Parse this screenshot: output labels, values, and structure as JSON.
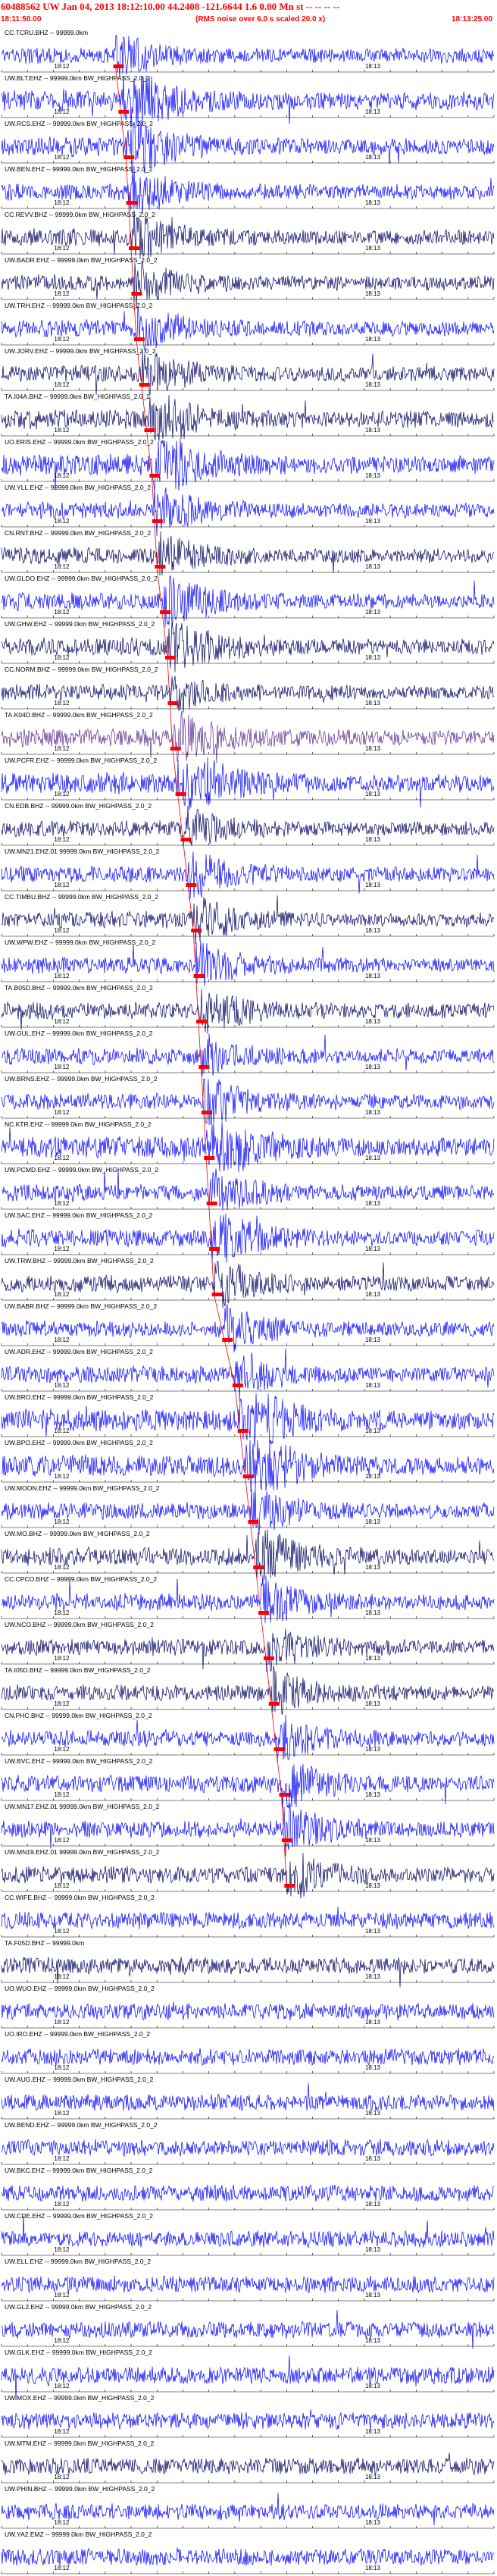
{
  "header": {
    "title": "60488562 UW Jan 04, 2013 18:12:10.00   44.2408 -121.6644   1.6  0.00 Mn st -- -- -- --",
    "start_time": "18:11:50.00",
    "rms_note": "(RMS noise over 6.0 s scaled 20.0 x)",
    "end_time": "18:13:25.00"
  },
  "minute_label": "18:12",
  "minute_label_2": "18:13",
  "colors": {
    "header_red": "#ff0000",
    "trace_blue": "#0000ff",
    "trace_navy": "#000060",
    "trace_purple": "#5a2c8c",
    "pick_red": "#ff0000",
    "tick_black": "#000000"
  },
  "chart_data": {
    "type": "seismogram",
    "x_unit": "time (UTC)",
    "xlim": [
      "18:11:50.00",
      "18:13:25.00"
    ],
    "traces": [
      {
        "label": "CC.TCRU.BHZ -- 99999.0km",
        "pick": "18:12:12.0",
        "color": "#0000ff",
        "amp": 0.45
      },
      {
        "label": "UW.BLT.EHZ -- 99999.0km BW_HIGHPASS_2.0_2",
        "pick": "18:12:13.0",
        "color": "#0000ff",
        "amp": 0.9
      },
      {
        "label": "UW.RCS.EHZ -- 99999.0km BW_HIGHPASS_2.0_2",
        "pick": "18:12:14.0",
        "color": "#0000ff",
        "amp": 0.7
      },
      {
        "label": "UW.BEN.EHZ -- 99999.0km BW_HIGHPASS_2.0_2",
        "pick": "18:12:14.5",
        "color": "#0000ff",
        "amp": 0.5
      },
      {
        "label": "CC.REVV.BHZ -- 99999.0km BW_HIGHPASS_2.0_2",
        "pick": "18:12:15.0",
        "color": "#000060",
        "amp": 0.5
      },
      {
        "label": "UW.BADR.EHZ -- 99999.0km BW_HIGHPASS_2.0_2",
        "pick": "18:12:15.5",
        "color": "#000060",
        "amp": 0.45
      },
      {
        "label": "UW.TRH.EHZ -- 99999.0km BW_HIGHPASS_2.0_2",
        "pick": "18:12:16.0",
        "color": "#0000ff",
        "amp": 0.5
      },
      {
        "label": "UW.JORV.EHZ -- 99999.0km BW_HIGHPASS_2.0_2",
        "pick": "18:12:17.0",
        "color": "#000060",
        "amp": 0.5
      },
      {
        "label": "TA.I04A.BHZ -- 99999.0km BW_HIGHPASS_2.0_2",
        "pick": "18:12:18.0",
        "color": "#000060",
        "amp": 0.7
      },
      {
        "label": "UO.ERIS.EHZ -- 99999.0km BW_HIGHPASS_2.0_2",
        "pick": "18:12:19.0",
        "color": "#0000ff",
        "amp": 0.9
      },
      {
        "label": "UW.YLL.EHZ -- 99999.0km BW_HIGHPASS_2.0_2",
        "pick": "18:12:19.5",
        "color": "#0000ff",
        "amp": 0.5
      },
      {
        "label": "CN.RNT.BHZ -- 99999.0km BW_HIGHPASS_2.0_2",
        "pick": "18:12:20.0",
        "color": "#000060",
        "amp": 0.45
      },
      {
        "label": "UW.GLDO.EHZ -- 99999.0km BW_HIGHPASS_2.0_2",
        "pick": "18:12:21.0",
        "color": "#0000ff",
        "amp": 0.6
      },
      {
        "label": "UW.GHW.EHZ -- 99999.0km BW_HIGHPASS_2.0_2",
        "pick": "18:12:22.0",
        "color": "#000060",
        "amp": 0.6
      },
      {
        "label": "CC.NORM.BHZ -- 99999.0km BW_HIGHPASS_2.0_2",
        "pick": "18:12:22.5",
        "color": "#000060",
        "amp": 0.4
      },
      {
        "label": "TA.K04D.BHZ -- 99999.0km BW_HIGHPASS_2.0_2",
        "pick": "18:12:23.0",
        "color": "#5a2c8c",
        "amp": 0.6
      },
      {
        "label": "UW.PCFR.EHZ -- 99999.0km BW_HIGHPASS_2.0_2",
        "pick": "18:12:24.0",
        "color": "#0000ff",
        "amp": 0.9
      },
      {
        "label": "CN.EDB.BHZ -- 99999.0km BW_HIGHPASS_2.0_2",
        "pick": "18:12:25.0",
        "color": "#000060",
        "amp": 0.4
      },
      {
        "label": "UW.MN21.EHZ.01 99999.0km BW_HIGHPASS_2.0_2",
        "pick": "18:12:26.0",
        "color": "#0000ff",
        "amp": 0.5
      },
      {
        "label": "CC.TIMBU.BHZ -- 99999.0km BW_HIGHPASS_2.0_2",
        "pick": "18:12:27.0",
        "color": "#000060",
        "amp": 0.5
      },
      {
        "label": "UW.WPW.EHZ -- 99999.0km BW_HIGHPASS_2.0_2",
        "pick": "18:12:27.5",
        "color": "#0000ff",
        "amp": 0.45
      },
      {
        "label": "TA.B05D.BHZ -- 99999.0km BW_HIGHPASS_2.0_2",
        "pick": "18:12:28.0",
        "color": "#000060",
        "amp": 0.5
      },
      {
        "label": "UW.GUL.EHZ -- 99999.0km BW_HIGHPASS_2.0_2",
        "pick": "18:12:28.5",
        "color": "#0000ff",
        "amp": 0.45
      },
      {
        "label": "UW.BRNS.EHZ -- 99999.0km BW_HIGHPASS_2.0_2",
        "pick": "18:12:29.0",
        "color": "#0000ff",
        "amp": 0.5
      },
      {
        "label": "NC.KTR.EHZ -- 99999.0km BW_HIGHPASS_2.0_2",
        "pick": "18:12:29.5",
        "color": "#0000ff",
        "amp": 0.95
      },
      {
        "label": "UW.PCMD.EHZ -- 99999.0km BW_HIGHPASS_2.0_2",
        "pick": "18:12:30.0",
        "color": "#0000ff",
        "amp": 0.5
      },
      {
        "label": "UW.SAC.EHZ -- 99999.0km BW_HIGHPASS_2.0_2",
        "pick": "18:12:30.5",
        "color": "#0000ff",
        "amp": 0.6
      },
      {
        "label": "UW.TRW.BHZ -- 99999.0km BW_HIGHPASS_2.0_2",
        "pick": "18:12:31.0",
        "color": "#000060",
        "amp": 0.5
      },
      {
        "label": "UW.BABR.BHZ -- 99999.0km BW_HIGHPASS_2.0_2",
        "pick": "18:12:33.0",
        "color": "#0000ff",
        "amp": 0.45
      },
      {
        "label": "UW.ADR.EHZ -- 99999.0km BW_HIGHPASS_2.0_2",
        "pick": "18:12:35.0",
        "color": "#0000ff",
        "amp": 0.5
      },
      {
        "label": "UW.BRO.EHZ -- 99999.0km BW_HIGHPASS_2.0_2",
        "pick": "18:12:36.0",
        "color": "#0000ff",
        "amp": 0.95
      },
      {
        "label": "UW.BPO.EHZ -- 99999.0km BW_HIGHPASS_2.0_2",
        "pick": "18:12:37.0",
        "color": "#0000ff",
        "amp": 0.95
      },
      {
        "label": "UW.MOON.EHZ -- 99999.0km BW_HIGHPASS_2.0_2",
        "pick": "18:12:38.0",
        "color": "#0000ff",
        "amp": 0.5
      },
      {
        "label": "UW.MO.BHZ -- 99999.0km BW_HIGHPASS_2.0_2",
        "pick": "18:12:39.0",
        "color": "#000060",
        "amp": 0.6
      },
      {
        "label": "CC.CPCO.BHZ -- 99999.0km BW_HIGHPASS_2.0_2",
        "pick": "18:12:40.0",
        "color": "#0000ff",
        "amp": 0.5
      },
      {
        "label": "UW.NCO.BHZ -- 99999.0km BW_HIGHPASS_2.0_2",
        "pick": "18:12:41.0",
        "color": "#000060",
        "amp": 0.45
      },
      {
        "label": "TA.I05D.BHZ -- 99999.0km BW_HIGHPASS_2.0_2",
        "pick": "18:12:42.0",
        "color": "#000060",
        "amp": 0.45
      },
      {
        "label": "CN.PHC.BHZ -- 99999.0km BW_HIGHPASS_2.0_2",
        "pick": "18:12:43.0",
        "color": "#0000ff",
        "amp": 0.45
      },
      {
        "label": "UW.BVC.EHZ -- 99999.0km BW_HIGHPASS_2.0_2",
        "pick": "18:12:44.0",
        "color": "#0000ff",
        "amp": 0.55
      },
      {
        "label": "UW.MN17.EHZ.01 99999.0km BW_HIGHPASS_2.0_2",
        "pick": "18:12:44.5",
        "color": "#0000ff",
        "amp": 0.5
      },
      {
        "label": "UW.MN19.EHZ.01 99999.0km BW_HIGHPASS_2.0_2",
        "pick": "18:12:45.0",
        "color": "#000060",
        "amp": 0.5
      },
      {
        "label": "CC.WIFE.BHZ -- 99999.0km BW_HIGHPASS_2.0_2",
        "pick": null,
        "color": "#0000ff",
        "amp": 0.45
      },
      {
        "label": "TA.F05D.BHZ -- 99999.0km",
        "pick": null,
        "color": "#000060",
        "amp": 0.45
      },
      {
        "label": "UO.WUO.EHZ -- 99999.0km BW_HIGHPASS_2.0_2",
        "pick": null,
        "color": "#0000ff",
        "amp": 0.45
      },
      {
        "label": "UO.IRO.EHZ -- 99999.0km BW_HIGHPASS_2.0_2",
        "pick": null,
        "color": "#0000ff",
        "amp": 0.45
      },
      {
        "label": "UW.AUG.EHZ -- 99999.0km BW_HIGHPASS_2.0_2",
        "pick": null,
        "color": "#0000ff",
        "amp": 0.45
      },
      {
        "label": "UW.BEND.EHZ -- 99999.0km BW_HIGHPASS_2.0_2",
        "pick": null,
        "color": "#0000ff",
        "amp": 0.45
      },
      {
        "label": "UW.BKC.EHZ -- 99999.0km BW_HIGHPASS_2.0_2",
        "pick": null,
        "color": "#0000ff",
        "amp": 0.45
      },
      {
        "label": "UW.CDE.EHZ -- 99999.0km BW_HIGHPASS_2.0_2",
        "pick": null,
        "color": "#0000ff",
        "amp": 0.45
      },
      {
        "label": "UW.ELL.EHZ -- 99999.0km BW_HIGHPASS_2.0_2",
        "pick": null,
        "color": "#0000ff",
        "amp": 0.45
      },
      {
        "label": "UW.GL2.EHZ -- 99999.0km BW_HIGHPASS_2.0_2",
        "pick": null,
        "color": "#0000ff",
        "amp": 0.45
      },
      {
        "label": "UW.GLK.EHZ -- 99999.0km BW_HIGHPASS_2.0_2",
        "pick": null,
        "color": "#0000ff",
        "amp": 0.5
      },
      {
        "label": "UW.MOX.EHZ -- 99999.0km BW_HIGHPASS_2.0_2",
        "pick": null,
        "color": "#0000ff",
        "amp": 0.45
      },
      {
        "label": "UW.MTM.EHZ -- 99999.0km BW_HIGHPASS_2.0_2",
        "pick": null,
        "color": "#000060",
        "amp": 0.45
      },
      {
        "label": "UW.PHIN.BHZ -- 99999.0km BW_HIGHPASS_2.0_2",
        "pick": null,
        "color": "#0000ff",
        "amp": 0.45
      },
      {
        "label": "UW.YA2.EMZ -- 99999.0km BW_HIGHPASS_2.0_2",
        "pick": null,
        "color": "#0000ff",
        "amp": 0.45
      }
    ]
  }
}
